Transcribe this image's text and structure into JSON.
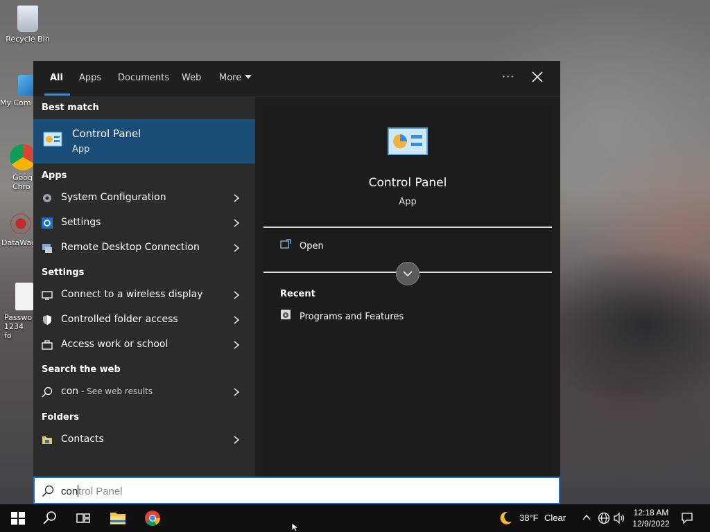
{
  "desktop": {
    "icons": [
      {
        "label": "Recycle Bin"
      },
      {
        "label": "My Com"
      },
      {
        "label": "Goog Chro"
      },
      {
        "label": "DataWag"
      },
      {
        "label": "Passwo 1234 fo"
      }
    ]
  },
  "search_panel": {
    "tabs": [
      "All",
      "Apps",
      "Documents",
      "Web",
      "More"
    ],
    "active_tab": "All",
    "more_dots": "···",
    "best_match_heading": "Best match",
    "best_match": {
      "name": "Control Panel",
      "type": "App"
    },
    "sections": [
      {
        "heading": "Apps",
        "items": [
          "System Configuration",
          "Settings",
          "Remote Desktop Connection"
        ]
      },
      {
        "heading": "Settings",
        "items": [
          "Connect to a wireless display",
          "Controlled folder access",
          "Access work or school"
        ]
      },
      {
        "heading": "Search the web",
        "items": [
          "con"
        ],
        "web_suffix": " - See web results"
      },
      {
        "heading": "Folders",
        "items": [
          "Contacts"
        ]
      }
    ],
    "preview": {
      "title": "Control Panel",
      "type": "App",
      "open_label": "Open",
      "recent_heading": "Recent",
      "recent_items": [
        "Programs and Features"
      ]
    }
  },
  "searchbox": {
    "typed": "con",
    "suggestion": "trol Panel"
  },
  "taskbar": {
    "weather_temp": "38°F",
    "weather_desc": "Clear",
    "time": "12:18 AM",
    "date": "12/9/2022"
  },
  "colors": {
    "accent": "#1a4d77",
    "panel_bg": "#1f1f1f",
    "list_bg": "#2b2b2b",
    "underline": "#3a8fd8"
  }
}
